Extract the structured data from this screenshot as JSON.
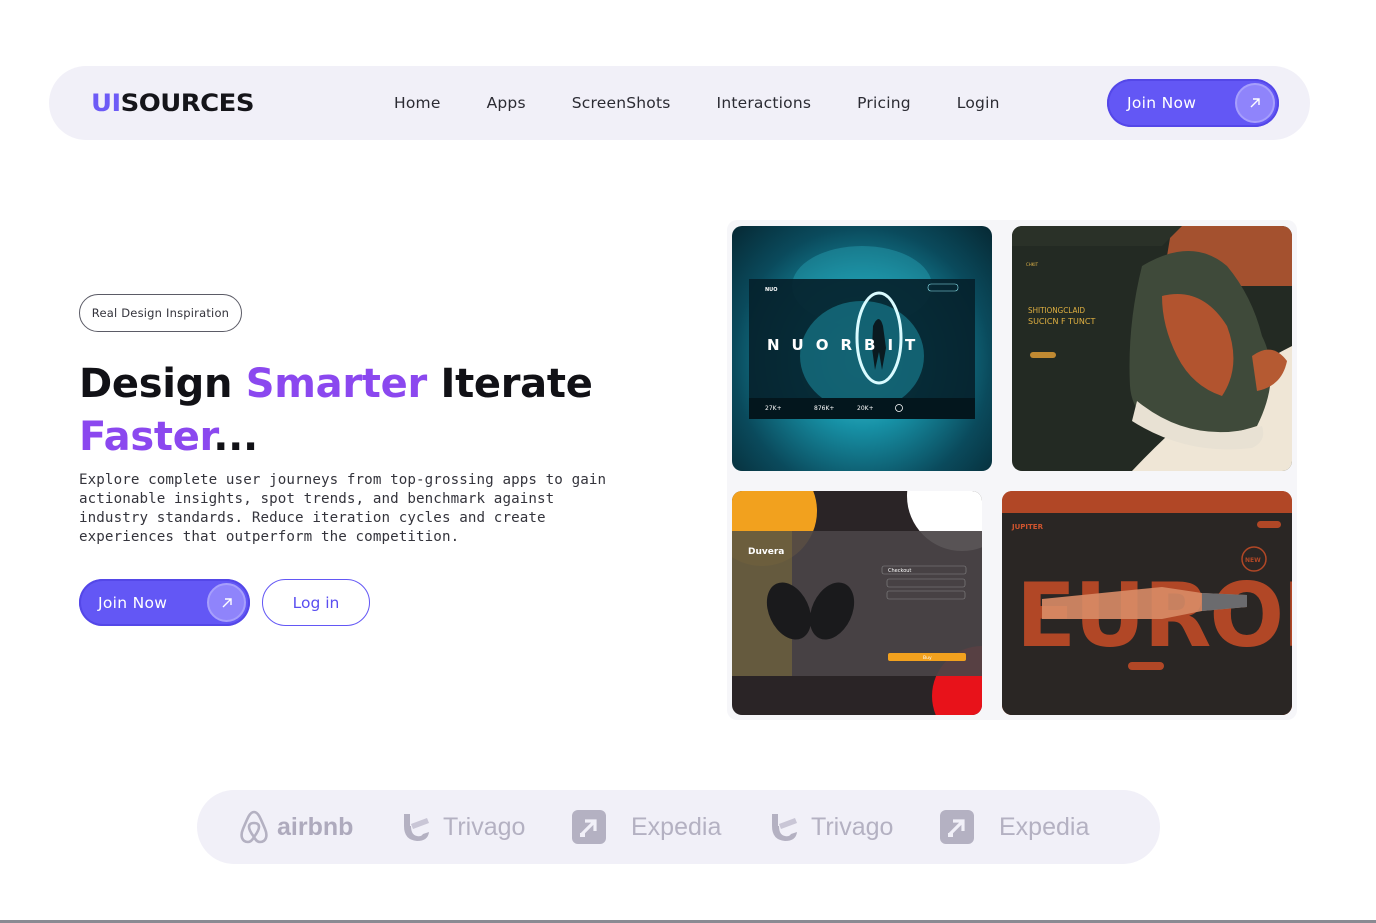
{
  "nav": {
    "logo_accent": "UI",
    "logo_rest": "SOURCES",
    "links": [
      "Home",
      "Apps",
      "ScreenShots",
      "Interactions",
      "Pricing",
      "Login"
    ],
    "join_label": "Join Now"
  },
  "hero": {
    "badge": "Real Design Inspiration",
    "headline_1": "Design ",
    "headline_accent_1": "Smarter",
    "headline_2": " Iterate ",
    "headline_accent_2": "Faster",
    "headline_3": "...",
    "lead": "Explore complete user journeys from top-grossing apps to gain actionable insights, spot trends, and benchmark against industry standards. Reduce iteration cycles and create experiences that outperform the competition.",
    "join_label": "Join Now",
    "login_label": "Log in"
  },
  "gallery": {
    "shot1": {
      "brand": "NUO",
      "title": "NUORBIT",
      "stats": [
        "27K+",
        "876K+",
        "20K+"
      ]
    },
    "shot2": {
      "brand": "CHKIT",
      "headline_1": "SHITIONGCLAID",
      "headline_2": "SUCICN F TUNCT"
    },
    "shot3": {
      "brand": "Duvera",
      "checkout": "Checkout",
      "buy": "Buy"
    },
    "shot4": {
      "brand": "JUPITER",
      "title": "EUROPA",
      "badge": "NEW"
    }
  },
  "brands": [
    "airbnb",
    "Trivago",
    "Expedia",
    "Trivago",
    "Expedia"
  ],
  "colors": {
    "accent": "#6357f5",
    "headline_accent": "#8b48ef",
    "nav_bg": "#f1f0f8"
  }
}
